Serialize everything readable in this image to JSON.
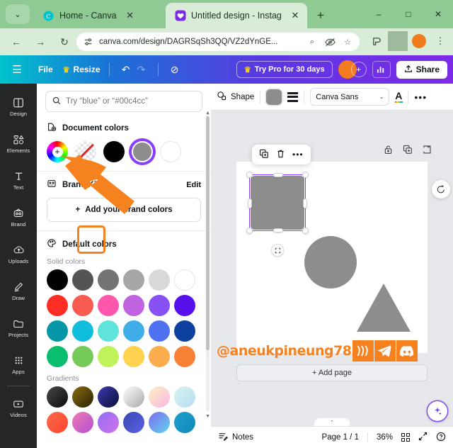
{
  "browser": {
    "tabs": [
      {
        "title": "Home - Canva",
        "active": false,
        "favicon": "canva-icon"
      },
      {
        "title": "Untitled design - Instagram",
        "active": true,
        "favicon": "canva-heart-icon"
      }
    ],
    "new_tab_label": "+",
    "window_controls": {
      "minimize": "–",
      "maximize": "□",
      "close": "✕"
    },
    "tab_close_label": "✕",
    "chevron_label": "⌄",
    "nav": {
      "back": "←",
      "forward": "→",
      "reload": "↻"
    },
    "url": "canva.com/design/DAGRSqSh3QQ/VZ2dYnGE...",
    "omnibox_icons": {
      "site_settings": "tune-icon",
      "zoom": "⌕",
      "hidden": "◉",
      "bookmark": "☆"
    },
    "toolbar_right": {
      "extensions": "⧉",
      "menu": "⋮"
    }
  },
  "canva_topbar": {
    "menu_icon": "☰",
    "file_label": "File",
    "resize_label": "Resize",
    "crown_icon": "♛",
    "undo_icon": "↶",
    "redo_icon": "↷",
    "cloud_icon": "⊘",
    "try_pro_label": "Try Pro for 30 days",
    "plus_label": "+",
    "chart_icon": "☰",
    "share_label": "Share",
    "share_icon": "⇧"
  },
  "rail": {
    "items": [
      {
        "label": "Design",
        "icon": "layout-icon",
        "glyph": "◫"
      },
      {
        "label": "Elements",
        "icon": "shapes-icon",
        "glyph": "⬚"
      },
      {
        "label": "Text",
        "icon": "text-icon",
        "glyph": "T"
      },
      {
        "label": "Brand",
        "icon": "brand-icon",
        "glyph": "◎"
      },
      {
        "label": "Uploads",
        "icon": "upload-cloud-icon",
        "glyph": "☁"
      },
      {
        "label": "Draw",
        "icon": "pen-icon",
        "glyph": "✎"
      },
      {
        "label": "Projects",
        "icon": "folder-icon",
        "glyph": "▱"
      },
      {
        "label": "Apps",
        "icon": "grid-apps-icon",
        "glyph": "∷"
      },
      {
        "label": "Videos",
        "icon": "video-icon",
        "glyph": "▷"
      }
    ]
  },
  "color_panel": {
    "search_placeholder": "Try “blue” or “#00c4cc”",
    "search_value": "",
    "search_icon": "⌕",
    "document_colors": {
      "title": "Document colors",
      "icon": "document-color-icon",
      "swatches": [
        {
          "name": "color-picker-wheel",
          "type": "wheel",
          "label": "+",
          "selected": true
        },
        {
          "name": "no-color",
          "type": "none",
          "color": "transparent"
        },
        {
          "name": "black",
          "type": "solid",
          "color": "#000000"
        },
        {
          "name": "gray-selected",
          "type": "solid-ring",
          "color": "#8d8d8d"
        },
        {
          "name": "white",
          "type": "white",
          "color": "#ffffff"
        }
      ]
    },
    "brand_kit": {
      "title": "Brand Kit",
      "icon": "brand-kit-icon",
      "edit_label": "Edit",
      "add_label": "Add your brand colors",
      "add_icon": "+"
    },
    "default_colors": {
      "title": "Default colors",
      "icon": "palette-icon",
      "solid_label": "Solid colors",
      "gradients_label": "Gradients",
      "solid": [
        "#000000",
        "#545454",
        "#737373",
        "#a6a6a6",
        "#d9d9d9",
        "#ffffff",
        "#ff2e24",
        "#fa5b51",
        "#ff57ab",
        "#bf63e0",
        "#8851f5",
        "#5611ec",
        "#0597a8",
        "#10bddc",
        "#5fe3da",
        "#3eade8",
        "#4f72f0",
        "#0c3f9e",
        "#0bbd6e",
        "#76ca5a",
        "#bff35c",
        "#ffd250",
        "#fbad4e",
        "#f98135"
      ],
      "gradients": [
        [
          "#4a4a4a",
          "#0a0a0a"
        ],
        [
          "#8a6b10",
          "#2b2105"
        ],
        [
          "#3b3bb0",
          "#0d0d3a"
        ],
        [
          "#ffffff",
          "#a9a9ad"
        ],
        [
          "#fff0c4",
          "#f9b6e0"
        ],
        [
          "#d6f4f0",
          "#b8ddf2"
        ],
        [
          "#ff6a4d",
          "#f8452c"
        ],
        [
          "#f07bb5",
          "#b34fd0"
        ],
        [
          "#8d6df5",
          "#d573e8"
        ],
        [
          "#3448b5",
          "#5d60e0"
        ],
        [
          "#7d6bf2",
          "#63d5ec"
        ],
        [
          "#1f9fd0",
          "#0f8ab5"
        ]
      ]
    }
  },
  "editor": {
    "toolbar": {
      "shape_label": "Shape",
      "shape_icon": "shape-icon",
      "color_chip": "#8d8d8d",
      "lines_icon": "line-style-icon",
      "font_name": "Canva Sans",
      "font_chevron": "⌄",
      "text_color_icon": "A",
      "more_icon": "•••"
    },
    "float_toolbar": {
      "duplicate_icon": "⧉",
      "delete_icon": "Ὕ1",
      "more_icon": "•••"
    },
    "object_tools": {
      "lock_icon": "ὑ3",
      "duplicate_icon": "⧉",
      "expand_icon": "↗"
    },
    "comment_icon": "comment-icon",
    "magic_icon": "magic-sparkle-icon",
    "rotate_icon": "rotate-icon",
    "add_page_label": "+ Add page",
    "shapes": [
      {
        "name": "rounded-square",
        "color": "#8d8d8d",
        "selected": true
      },
      {
        "name": "circle",
        "color": "#8d8d8d",
        "selected": false
      },
      {
        "name": "triangle",
        "color": "#8d8d8d",
        "selected": false
      }
    ]
  },
  "watermark": {
    "handle": "@aneukpineung78",
    "color": "#f5821f",
    "badges": [
      "waves-icon",
      "telegram-icon",
      "discord-icon"
    ]
  },
  "bottom_bar": {
    "notes_label": "Notes",
    "notes_icon": "notes-icon",
    "page_label": "Page 1 / 1",
    "zoom_label": "36%",
    "grid_icon": "grid-view-icon",
    "fullscreen_icon": "↗",
    "help_icon": "?",
    "collapse_icon": "⌃"
  }
}
